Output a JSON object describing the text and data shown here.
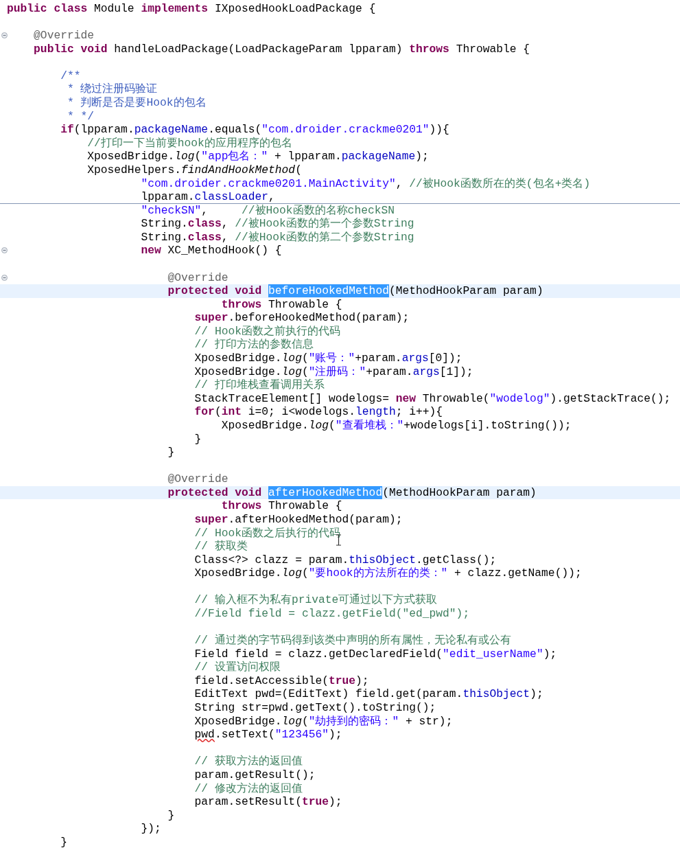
{
  "editor": {
    "lines": [
      {
        "kind": "code",
        "segments": [
          {
            "text": "public",
            "kind": "keyword"
          },
          {
            "text": " class",
            "kind": "keyword"
          },
          {
            "text": " Module ",
            "kind": "plain"
          },
          {
            "text": "implements",
            "kind": "keyword"
          },
          {
            "text": " IXposedHookLoadPackage {",
            "kind": "plain"
          }
        ],
        "highlighted": false,
        "fold_marker": false,
        "rule_below": false
      },
      {
        "kind": "blank"
      },
      {
        "kind": "code",
        "segments": [
          {
            "text": "    @Override",
            "kind": "annotation"
          }
        ],
        "highlighted": false,
        "fold_marker": true,
        "rule_below": false
      },
      {
        "kind": "code",
        "segments": [
          {
            "text": "    public",
            "kind": "keyword"
          },
          {
            "text": " void",
            "kind": "keyword"
          },
          {
            "text": " handleLoadPackage(LoadPackageParam lpparam) ",
            "kind": "plain"
          },
          {
            "text": "throws",
            "kind": "keyword"
          },
          {
            "text": " Throwable {",
            "kind": "plain"
          }
        ],
        "highlighted": false,
        "fold_marker": false,
        "rule_below": false
      },
      {
        "kind": "blank"
      },
      {
        "kind": "code",
        "segments": [
          {
            "text": "        /**",
            "kind": "javadoc"
          }
        ],
        "highlighted": false,
        "fold_marker": false,
        "rule_below": false
      },
      {
        "kind": "code",
        "segments": [
          {
            "text": "         * 绕过注册码验证",
            "kind": "javadoc"
          }
        ],
        "highlighted": false,
        "fold_marker": false,
        "rule_below": false
      },
      {
        "kind": "code",
        "segments": [
          {
            "text": "         * 判断是否是要Hook的包名",
            "kind": "javadoc"
          }
        ],
        "highlighted": false,
        "fold_marker": false,
        "rule_below": false
      },
      {
        "kind": "code",
        "segments": [
          {
            "text": "         * */",
            "kind": "javadoc"
          }
        ],
        "highlighted": false,
        "fold_marker": false,
        "rule_below": false
      },
      {
        "kind": "code",
        "segments": [
          {
            "text": "        if",
            "kind": "keyword"
          },
          {
            "text": "(lpparam.",
            "kind": "plain"
          },
          {
            "text": "packageName",
            "kind": "field"
          },
          {
            "text": ".equals(",
            "kind": "plain"
          },
          {
            "text": "\"com.droider.crackme0201\"",
            "kind": "string"
          },
          {
            "text": ")){",
            "kind": "plain"
          }
        ],
        "highlighted": false,
        "fold_marker": false,
        "rule_below": false
      },
      {
        "kind": "code",
        "segments": [
          {
            "text": "            //打印一下当前要hook的应用程序的包名",
            "kind": "comment"
          }
        ],
        "highlighted": false,
        "fold_marker": false,
        "rule_below": false
      },
      {
        "kind": "code",
        "segments": [
          {
            "text": "            XposedBridge.",
            "kind": "plain"
          },
          {
            "text": "log",
            "kind": "static"
          },
          {
            "text": "(",
            "kind": "plain"
          },
          {
            "text": "\"app包名：\"",
            "kind": "string"
          },
          {
            "text": " + lpparam.",
            "kind": "plain"
          },
          {
            "text": "packageName",
            "kind": "field"
          },
          {
            "text": ");",
            "kind": "plain"
          }
        ],
        "highlighted": false,
        "fold_marker": false,
        "rule_below": false
      },
      {
        "kind": "code",
        "segments": [
          {
            "text": "            XposedHelpers.",
            "kind": "plain"
          },
          {
            "text": "findAndHookMethod",
            "kind": "static"
          },
          {
            "text": "(",
            "kind": "plain"
          }
        ],
        "highlighted": false,
        "fold_marker": false,
        "rule_below": false
      },
      {
        "kind": "code",
        "segments": [
          {
            "text": "                    \"com.droider.crackme0201.MainActivity\"",
            "kind": "string"
          },
          {
            "text": ", ",
            "kind": "plain"
          },
          {
            "text": "//被Hook函数所在的类(包名+类名)",
            "kind": "comment"
          }
        ],
        "highlighted": false,
        "fold_marker": false,
        "rule_below": false
      },
      {
        "kind": "code",
        "segments": [
          {
            "text": "                    lpparam.",
            "kind": "plain"
          },
          {
            "text": "classLoader",
            "kind": "field"
          },
          {
            "text": ",",
            "kind": "plain"
          }
        ],
        "highlighted": false,
        "fold_marker": false,
        "rule_below": true
      },
      {
        "kind": "code",
        "segments": [
          {
            "text": "                    \"checkSN\"",
            "kind": "string"
          },
          {
            "text": ",     ",
            "kind": "plain"
          },
          {
            "text": "//被Hook函数的名称checkSN",
            "kind": "comment"
          }
        ],
        "highlighted": false,
        "fold_marker": false,
        "rule_below": false
      },
      {
        "kind": "code",
        "segments": [
          {
            "text": "                    String.",
            "kind": "plain"
          },
          {
            "text": "class",
            "kind": "keyword"
          },
          {
            "text": ", ",
            "kind": "plain"
          },
          {
            "text": "//被Hook函数的第一个参数String",
            "kind": "comment"
          }
        ],
        "highlighted": false,
        "fold_marker": false,
        "rule_below": false
      },
      {
        "kind": "code",
        "segments": [
          {
            "text": "                    String.",
            "kind": "plain"
          },
          {
            "text": "class",
            "kind": "keyword"
          },
          {
            "text": ", ",
            "kind": "plain"
          },
          {
            "text": "//被Hook函数的第二个参数String",
            "kind": "comment"
          }
        ],
        "highlighted": false,
        "fold_marker": false,
        "rule_below": false
      },
      {
        "kind": "code",
        "segments": [
          {
            "text": "                    new",
            "kind": "keyword"
          },
          {
            "text": " XC_MethodHook() {",
            "kind": "plain"
          }
        ],
        "highlighted": false,
        "fold_marker": true,
        "rule_below": false
      },
      {
        "kind": "blank"
      },
      {
        "kind": "code",
        "segments": [
          {
            "text": "                        @Override",
            "kind": "annotation"
          }
        ],
        "highlighted": false,
        "fold_marker": true,
        "rule_below": false
      },
      {
        "kind": "code",
        "segments": [
          {
            "text": "                        protected",
            "kind": "keyword"
          },
          {
            "text": " void ",
            "kind": "keyword"
          },
          {
            "text": "beforeHookedMethod",
            "kind": "selection"
          },
          {
            "text": "(MethodHookParam param)",
            "kind": "plain"
          }
        ],
        "highlighted": true,
        "fold_marker": false,
        "rule_below": false
      },
      {
        "kind": "code",
        "segments": [
          {
            "text": "                                throws",
            "kind": "keyword"
          },
          {
            "text": " Throwable {",
            "kind": "plain"
          }
        ],
        "highlighted": false,
        "fold_marker": false,
        "rule_below": false
      },
      {
        "kind": "code",
        "segments": [
          {
            "text": "                            super",
            "kind": "keyword"
          },
          {
            "text": ".beforeHookedMethod(param);",
            "kind": "plain"
          }
        ],
        "highlighted": false,
        "fold_marker": false,
        "rule_below": false
      },
      {
        "kind": "code",
        "segments": [
          {
            "text": "                            // Hook函数之前执行的代码",
            "kind": "comment"
          }
        ],
        "highlighted": false,
        "fold_marker": false,
        "rule_below": false
      },
      {
        "kind": "code",
        "segments": [
          {
            "text": "                            // 打印方法的参数信息",
            "kind": "comment"
          }
        ],
        "highlighted": false,
        "fold_marker": false,
        "rule_below": false
      },
      {
        "kind": "code",
        "segments": [
          {
            "text": "                            XposedBridge.",
            "kind": "plain"
          },
          {
            "text": "log",
            "kind": "static"
          },
          {
            "text": "(",
            "kind": "plain"
          },
          {
            "text": "\"账号：\"",
            "kind": "string"
          },
          {
            "text": "+param.",
            "kind": "plain"
          },
          {
            "text": "args",
            "kind": "field"
          },
          {
            "text": "[0]);",
            "kind": "plain"
          }
        ],
        "highlighted": false,
        "fold_marker": false,
        "rule_below": false
      },
      {
        "kind": "code",
        "segments": [
          {
            "text": "                            XposedBridge.",
            "kind": "plain"
          },
          {
            "text": "log",
            "kind": "static"
          },
          {
            "text": "(",
            "kind": "plain"
          },
          {
            "text": "\"注册码：\"",
            "kind": "string"
          },
          {
            "text": "+param.",
            "kind": "plain"
          },
          {
            "text": "args",
            "kind": "field"
          },
          {
            "text": "[1]);",
            "kind": "plain"
          }
        ],
        "highlighted": false,
        "fold_marker": false,
        "rule_below": false
      },
      {
        "kind": "code",
        "segments": [
          {
            "text": "                            // 打印堆栈查看调用关系",
            "kind": "comment"
          }
        ],
        "highlighted": false,
        "fold_marker": false,
        "rule_below": false
      },
      {
        "kind": "code",
        "segments": [
          {
            "text": "                            StackTraceElement[] wodelogs= ",
            "kind": "plain"
          },
          {
            "text": "new",
            "kind": "keyword"
          },
          {
            "text": " Throwable(",
            "kind": "plain"
          },
          {
            "text": "\"wodelog\"",
            "kind": "string"
          },
          {
            "text": ").getStackTrace();",
            "kind": "plain"
          }
        ],
        "highlighted": false,
        "fold_marker": false,
        "rule_below": false
      },
      {
        "kind": "code",
        "segments": [
          {
            "text": "                            for",
            "kind": "keyword"
          },
          {
            "text": "(",
            "kind": "plain"
          },
          {
            "text": "int",
            "kind": "keyword"
          },
          {
            "text": " i=0; i<wodelogs.",
            "kind": "plain"
          },
          {
            "text": "length",
            "kind": "field"
          },
          {
            "text": "; i++){",
            "kind": "plain"
          }
        ],
        "highlighted": false,
        "fold_marker": false,
        "rule_below": false
      },
      {
        "kind": "code",
        "segments": [
          {
            "text": "                                XposedBridge.",
            "kind": "plain"
          },
          {
            "text": "log",
            "kind": "static"
          },
          {
            "text": "(",
            "kind": "plain"
          },
          {
            "text": "\"查看堆栈：\"",
            "kind": "string"
          },
          {
            "text": "+wodelogs[i].toString());",
            "kind": "plain"
          }
        ],
        "highlighted": false,
        "fold_marker": false,
        "rule_below": false
      },
      {
        "kind": "code",
        "segments": [
          {
            "text": "                            }",
            "kind": "plain"
          }
        ],
        "highlighted": false,
        "fold_marker": false,
        "rule_below": false
      },
      {
        "kind": "code",
        "segments": [
          {
            "text": "                        }",
            "kind": "plain"
          }
        ],
        "highlighted": false,
        "fold_marker": false,
        "rule_below": false
      },
      {
        "kind": "blank"
      },
      {
        "kind": "code",
        "segments": [
          {
            "text": "                        @Override",
            "kind": "annotation"
          }
        ],
        "highlighted": false,
        "fold_marker": false,
        "rule_below": false
      },
      {
        "kind": "code",
        "segments": [
          {
            "text": "                        protected",
            "kind": "keyword"
          },
          {
            "text": " void ",
            "kind": "keyword"
          },
          {
            "text": "afterHookedMethod",
            "kind": "selection"
          },
          {
            "text": "(MethodHookParam param)",
            "kind": "plain"
          }
        ],
        "highlighted": true,
        "fold_marker": false,
        "rule_below": false
      },
      {
        "kind": "code",
        "segments": [
          {
            "text": "                                throws",
            "kind": "keyword"
          },
          {
            "text": " Throwable {",
            "kind": "plain"
          }
        ],
        "highlighted": false,
        "fold_marker": false,
        "rule_below": false
      },
      {
        "kind": "code",
        "segments": [
          {
            "text": "                            super",
            "kind": "keyword"
          },
          {
            "text": ".afterHookedMethod(param);",
            "kind": "plain"
          }
        ],
        "highlighted": false,
        "fold_marker": false,
        "rule_below": false
      },
      {
        "kind": "code",
        "segments": [
          {
            "text": "                            // Hook函数之后执行的代码",
            "kind": "comment"
          }
        ],
        "highlighted": false,
        "fold_marker": false,
        "rule_below": false
      },
      {
        "kind": "code",
        "segments": [
          {
            "text": "                            // 获取类",
            "kind": "comment"
          }
        ],
        "highlighted": false,
        "fold_marker": false,
        "rule_below": false
      },
      {
        "kind": "code",
        "segments": [
          {
            "text": "                            Class<?> clazz = param.",
            "kind": "plain"
          },
          {
            "text": "thisObject",
            "kind": "field"
          },
          {
            "text": ".getClass();",
            "kind": "plain"
          }
        ],
        "highlighted": false,
        "fold_marker": false,
        "rule_below": false
      },
      {
        "kind": "code",
        "segments": [
          {
            "text": "                            XposedBridge.",
            "kind": "plain"
          },
          {
            "text": "log",
            "kind": "static"
          },
          {
            "text": "(",
            "kind": "plain"
          },
          {
            "text": "\"要hook的方法所在的类：\"",
            "kind": "string"
          },
          {
            "text": " + clazz.getName());",
            "kind": "plain"
          }
        ],
        "highlighted": false,
        "fold_marker": false,
        "rule_below": false
      },
      {
        "kind": "blank"
      },
      {
        "kind": "code",
        "segments": [
          {
            "text": "                            // 输入框不为私有private可通过以下方式获取",
            "kind": "comment"
          }
        ],
        "highlighted": false,
        "fold_marker": false,
        "rule_below": false
      },
      {
        "kind": "code",
        "segments": [
          {
            "text": "                            //Field field = clazz.getField(\"ed_pwd\");",
            "kind": "comment"
          }
        ],
        "highlighted": false,
        "fold_marker": false,
        "rule_below": false
      },
      {
        "kind": "blank"
      },
      {
        "kind": "code",
        "segments": [
          {
            "text": "                            // 通过类的字节码得到该类中声明的所有属性，无论私有或公有",
            "kind": "comment"
          }
        ],
        "highlighted": false,
        "fold_marker": false,
        "rule_below": false
      },
      {
        "kind": "code",
        "segments": [
          {
            "text": "                            Field field = clazz.getDeclaredField(",
            "kind": "plain"
          },
          {
            "text": "\"edit_userName\"",
            "kind": "string"
          },
          {
            "text": ");",
            "kind": "plain"
          }
        ],
        "highlighted": false,
        "fold_marker": false,
        "rule_below": false
      },
      {
        "kind": "code",
        "segments": [
          {
            "text": "                            // 设置访问权限",
            "kind": "comment"
          }
        ],
        "highlighted": false,
        "fold_marker": false,
        "rule_below": false
      },
      {
        "kind": "code",
        "segments": [
          {
            "text": "                            field.setAccessible(",
            "kind": "plain"
          },
          {
            "text": "true",
            "kind": "keyword"
          },
          {
            "text": ");",
            "kind": "plain"
          }
        ],
        "highlighted": false,
        "fold_marker": false,
        "rule_below": false
      },
      {
        "kind": "code",
        "segments": [
          {
            "text": "                            EditText pwd=(EditText) field.get(param.",
            "kind": "plain"
          },
          {
            "text": "thisObject",
            "kind": "field"
          },
          {
            "text": ");",
            "kind": "plain"
          }
        ],
        "highlighted": false,
        "fold_marker": false,
        "rule_below": false
      },
      {
        "kind": "code",
        "segments": [
          {
            "text": "                            String str=pwd.getText().toString();",
            "kind": "plain"
          }
        ],
        "highlighted": false,
        "fold_marker": false,
        "rule_below": false
      },
      {
        "kind": "code",
        "segments": [
          {
            "text": "                            XposedBridge.",
            "kind": "plain"
          },
          {
            "text": "log",
            "kind": "static"
          },
          {
            "text": "(",
            "kind": "plain"
          },
          {
            "text": "\"劫持到的密码：\"",
            "kind": "string"
          },
          {
            "text": " + str);",
            "kind": "plain"
          }
        ],
        "highlighted": false,
        "fold_marker": false,
        "rule_below": false
      },
      {
        "kind": "code",
        "segments": [
          {
            "text": "                            pwd",
            "kind": "warning"
          },
          {
            "text": ".setText(",
            "kind": "plain"
          },
          {
            "text": "\"123456\"",
            "kind": "string"
          },
          {
            "text": ");",
            "kind": "plain"
          }
        ],
        "highlighted": false,
        "fold_marker": false,
        "rule_below": false
      },
      {
        "kind": "blank"
      },
      {
        "kind": "code",
        "segments": [
          {
            "text": "                            // 获取方法的返回值",
            "kind": "comment"
          }
        ],
        "highlighted": false,
        "fold_marker": false,
        "rule_below": false
      },
      {
        "kind": "code",
        "segments": [
          {
            "text": "                            param.getResult();",
            "kind": "plain"
          }
        ],
        "highlighted": false,
        "fold_marker": false,
        "rule_below": false
      },
      {
        "kind": "code",
        "segments": [
          {
            "text": "                            // 修改方法的返回值",
            "kind": "comment"
          }
        ],
        "highlighted": false,
        "fold_marker": false,
        "rule_below": false
      },
      {
        "kind": "code",
        "segments": [
          {
            "text": "                            param.setResult(",
            "kind": "plain"
          },
          {
            "text": "true",
            "kind": "keyword"
          },
          {
            "text": ");",
            "kind": "plain"
          }
        ],
        "highlighted": false,
        "fold_marker": false,
        "rule_below": false
      },
      {
        "kind": "code",
        "segments": [
          {
            "text": "                        }",
            "kind": "plain"
          }
        ],
        "highlighted": false,
        "fold_marker": false,
        "rule_below": false
      },
      {
        "kind": "code",
        "segments": [
          {
            "text": "                    });",
            "kind": "plain"
          }
        ],
        "highlighted": false,
        "fold_marker": false,
        "rule_below": false
      },
      {
        "kind": "code",
        "segments": [
          {
            "text": "        }",
            "kind": "plain"
          }
        ],
        "highlighted": false,
        "fold_marker": false,
        "rule_below": false
      }
    ]
  }
}
